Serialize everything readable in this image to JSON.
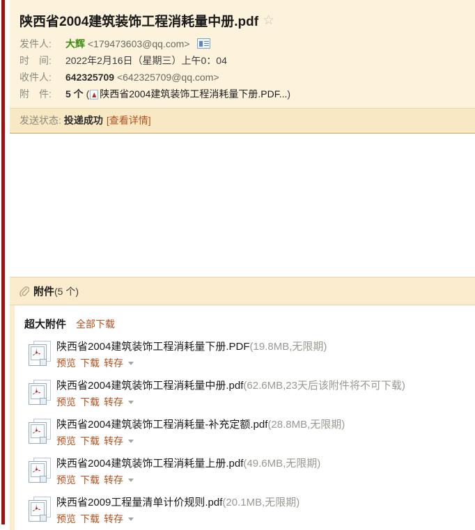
{
  "window": {
    "accent_rail_color": "#9c1212",
    "header_bg": "#fdf2dc",
    "status_bg": "#f8e8c4",
    "link_color": "#b5501e",
    "sender_name_color": "#3d8a12"
  },
  "mail": {
    "subject": "陕西省2004建筑装饰工程消耗量中册.pdf",
    "star_glyph": "☆",
    "fields": {
      "sender_label": "发件人:",
      "sender_name": "大辉",
      "sender_email": "<179473603@qq.com>",
      "time_label": "时　间:",
      "time_value": "2022年2月16日（星期三）上午0：04",
      "recipient_label": "收件人:",
      "recipient_name": "642325709",
      "recipient_email": "<642325709@qq.com>",
      "attach_label": "附　件:",
      "attach_count_text": "5 个",
      "attach_preview_open": "(",
      "attach_preview_name": "陕西省2004建筑装饰工程消耗量下册.PDF...",
      "attach_preview_close": ")"
    },
    "status": {
      "label": "发送状态:",
      "value": "投递成功",
      "detail_link": "[查看详情]"
    }
  },
  "attachments_panel": {
    "clip_icon": "paperclip-icon",
    "title": "附件",
    "count_text": "(5 个)",
    "bigfile_label": "超大附件",
    "download_all_label": "全部下载",
    "actions": {
      "preview": "预览",
      "download": "下载",
      "save": "转存"
    },
    "items": [
      {
        "name": "陕西省2004建筑装饰工程消耗量下册.PDF",
        "size": "(19.8MB,无限期)",
        "icon": "pdf-file-icon"
      },
      {
        "name": "陕西省2004建筑装饰工程消耗量中册.pdf",
        "size": "(62.6MB,23天后该附件将不可下载)",
        "icon": "pdf-file-icon"
      },
      {
        "name": "陕西省2004建筑装饰工程消耗量-补充定额.pdf",
        "size": "(28.8MB,无限期)",
        "icon": "pdf-file-icon"
      },
      {
        "name": "陕西省2004建筑装饰工程消耗量上册.pdf",
        "size": "(49.6MB,无限期)",
        "icon": "pdf-file-icon"
      },
      {
        "name": "陕西省2009工程量清单计价规则.pdf",
        "size": "(20.1MB,无限期)",
        "icon": "pdf-file-icon"
      }
    ]
  }
}
